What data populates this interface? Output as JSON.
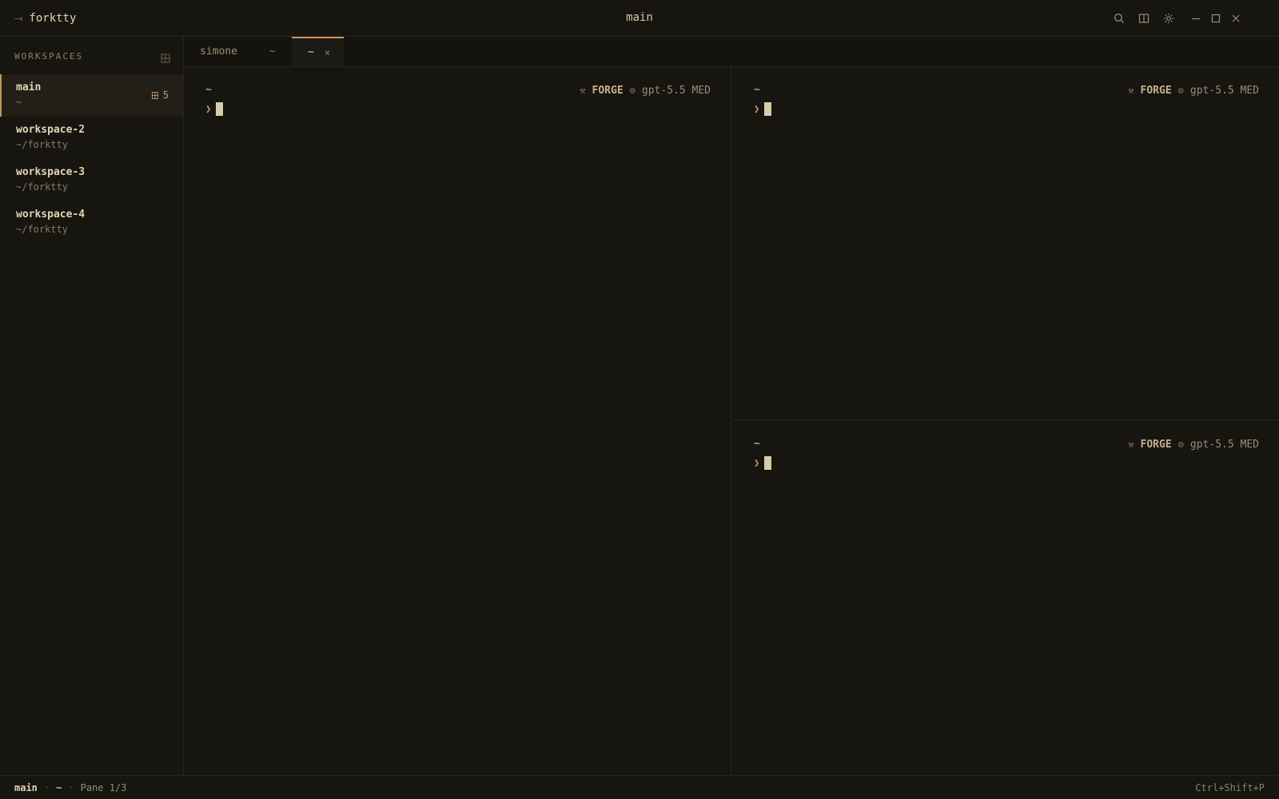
{
  "app": {
    "brand_glyph": "⤙",
    "name": "forktty",
    "window_title": "main"
  },
  "titlebar_icons": [
    "search-icon",
    "split-view-icon",
    "settings-icon",
    "minimize-icon",
    "maximize-icon",
    "close-icon"
  ],
  "sidebar": {
    "header": "WORKSPACES",
    "header_icon": "new-workspace-icon",
    "items": [
      {
        "name": "main",
        "path": "~",
        "active": true,
        "badge_count": "5"
      },
      {
        "name": "workspace-2",
        "path": "~/forktty",
        "active": false
      },
      {
        "name": "workspace-3",
        "path": "~/forktty",
        "active": false
      },
      {
        "name": "workspace-4",
        "path": "~/forktty",
        "active": false
      }
    ]
  },
  "tabs": [
    {
      "label": "simone",
      "sub": "~",
      "active": false
    },
    {
      "label": "~",
      "close": "×",
      "active": true
    }
  ],
  "panes": [
    {
      "cwd": "~",
      "prompt": "❯",
      "agent_icon": "⚒",
      "agent": "FORGE",
      "model_icon": "⚙",
      "model": "gpt-5.5 MED"
    },
    {
      "cwd": "~",
      "prompt": "❯",
      "agent_icon": "⚒",
      "agent": "FORGE",
      "model_icon": "⚙",
      "model": "gpt-5.5 MED"
    },
    {
      "cwd": "~",
      "prompt": "❯",
      "agent_icon": "⚒",
      "agent": "FORGE",
      "model_icon": "⚙",
      "model": "gpt-5.5 MED"
    }
  ],
  "statusbar": {
    "workspace": "main",
    "sep": "·",
    "cwd": "~",
    "pane": "Pane 1/3",
    "shortcut": "Ctrl+Shift+P"
  },
  "colors": {
    "background": "#161510",
    "accent": "#c8955f",
    "text": "#e4d6b4",
    "muted": "#877b64"
  }
}
